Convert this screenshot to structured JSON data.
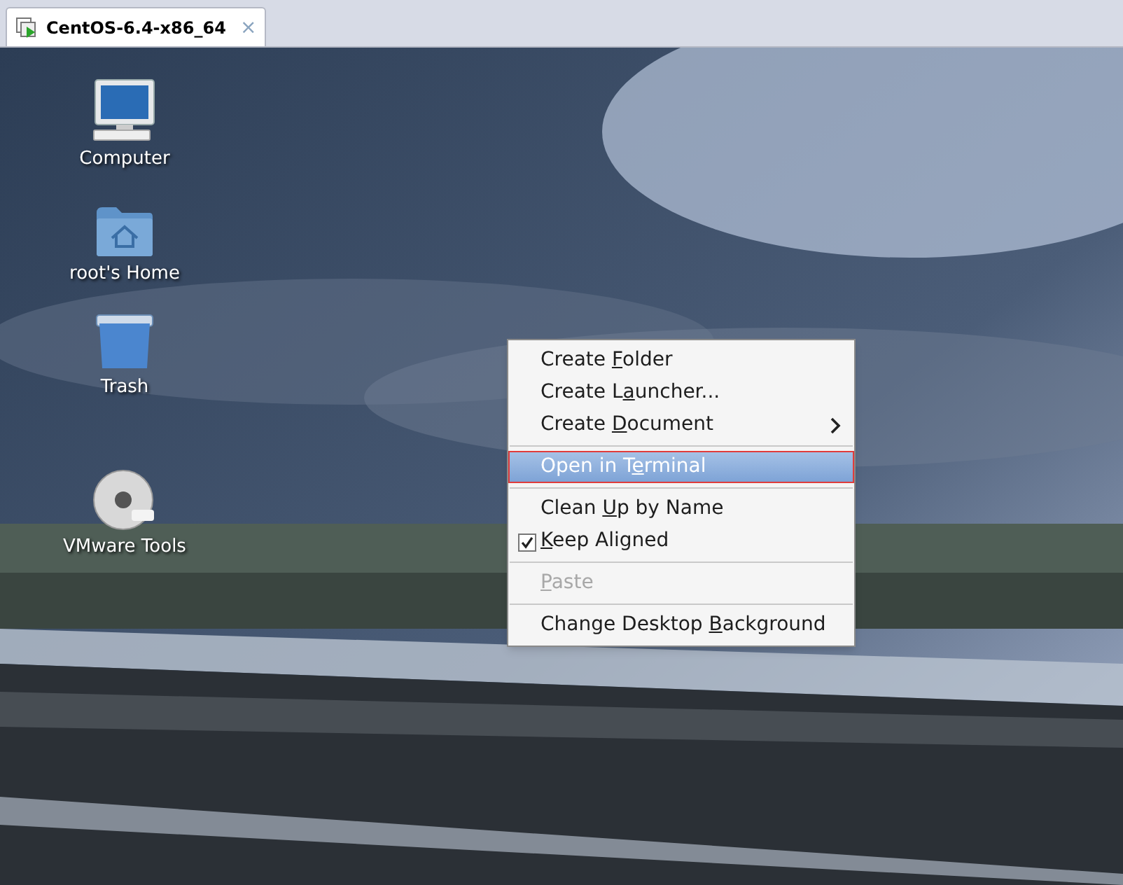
{
  "tab": {
    "title": "CentOS-6.4-x86_64",
    "close": "×",
    "selected": true
  },
  "desktop_icons": [
    {
      "kind": "computer",
      "label": "Computer"
    },
    {
      "kind": "home",
      "label": "root's Home"
    },
    {
      "kind": "trash",
      "label": "Trash"
    },
    {
      "kind": "dvd",
      "label": "VMware Tools"
    }
  ],
  "context_menu": [
    {
      "kind": "item",
      "before": "Create ",
      "key": "F",
      "after": "older",
      "selected": false,
      "checked": false,
      "disabled": false,
      "submenu": false
    },
    {
      "kind": "item",
      "before": "Create L",
      "key": "a",
      "after": "uncher...",
      "selected": false,
      "checked": false,
      "disabled": false,
      "submenu": false
    },
    {
      "kind": "item",
      "before": "Create ",
      "key": "D",
      "after": "ocument",
      "selected": false,
      "checked": false,
      "disabled": false,
      "submenu": true
    },
    {
      "kind": "separator"
    },
    {
      "kind": "item",
      "before": "Open in T",
      "key": "e",
      "after": "rminal",
      "selected": true,
      "checked": false,
      "disabled": false,
      "submenu": false
    },
    {
      "kind": "separator"
    },
    {
      "kind": "item",
      "before": "Clean ",
      "key": "U",
      "after": "p by Name",
      "selected": false,
      "checked": false,
      "disabled": false,
      "submenu": false
    },
    {
      "kind": "item",
      "key": "K",
      "after": "eep Aligned",
      "selected": false,
      "checked": true,
      "disabled": false,
      "submenu": false
    },
    {
      "kind": "separator"
    },
    {
      "kind": "item",
      "key": "P",
      "after": "aste",
      "selected": false,
      "checked": false,
      "disabled": true,
      "submenu": false
    },
    {
      "kind": "separator"
    },
    {
      "kind": "item",
      "before": "Change Desktop ",
      "key": "B",
      "after": "ackground",
      "selected": false,
      "checked": false,
      "disabled": false,
      "submenu": false
    }
  ]
}
